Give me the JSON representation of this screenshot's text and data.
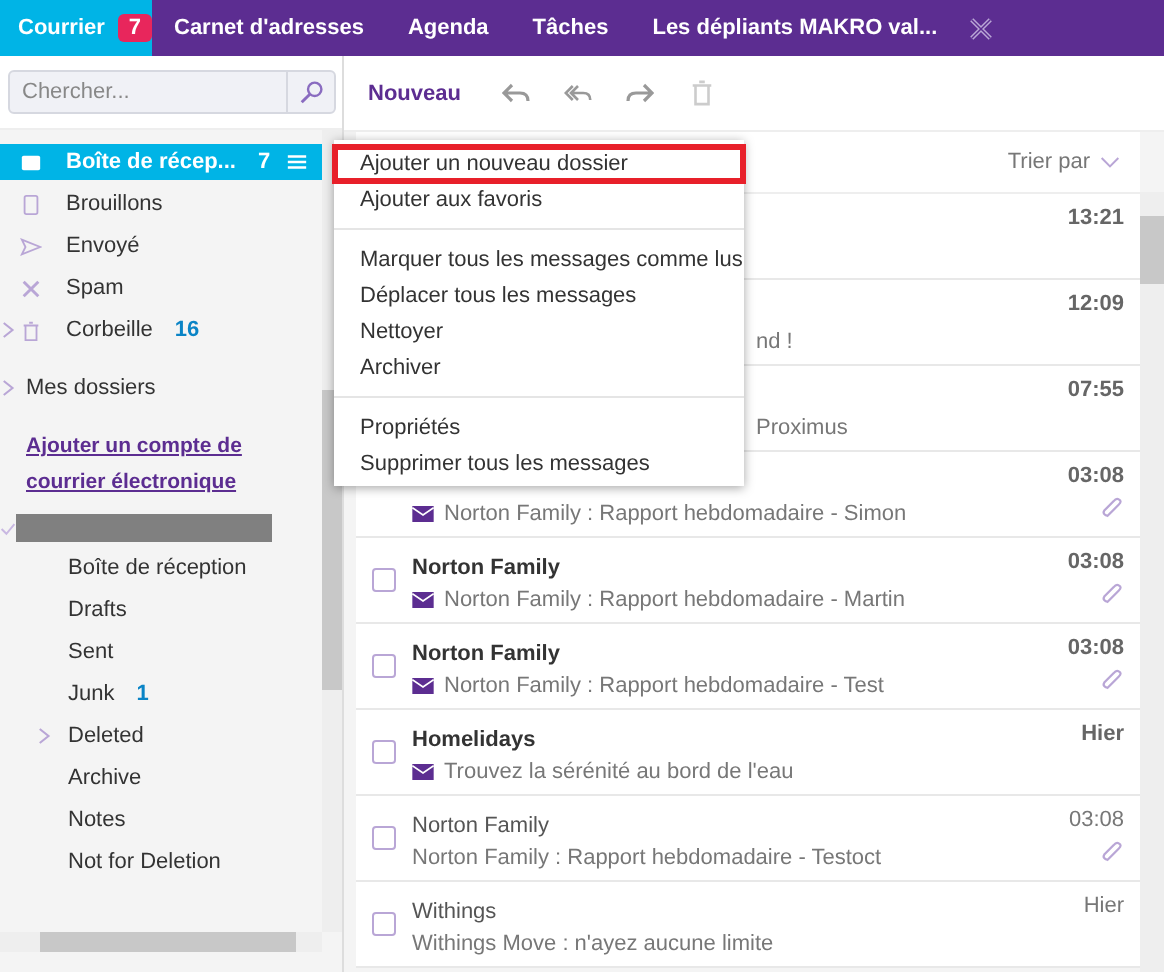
{
  "nav": {
    "tabs": [
      {
        "label": "Courrier",
        "badge": "7",
        "selected": true
      },
      {
        "label": "Carnet d'adresses",
        "selected": false
      },
      {
        "label": "Agenda",
        "selected": false
      },
      {
        "label": "Tâches",
        "selected": false
      },
      {
        "label": "Les dépliants MAKRO val...",
        "selected": false
      }
    ]
  },
  "search": {
    "placeholder": "Chercher..."
  },
  "toolbar": {
    "new_label": "Nouveau"
  },
  "folders": [
    {
      "label": "Boîte de récep...",
      "count": "7",
      "selected": true,
      "expandable": false
    },
    {
      "label": "Brouillons",
      "selected": false,
      "expandable": false
    },
    {
      "label": "Envoyé",
      "selected": false,
      "expandable": false
    },
    {
      "label": "Spam",
      "selected": false,
      "expandable": false
    },
    {
      "label": "Corbeille",
      "count": "16",
      "selected": false,
      "expandable": true
    }
  ],
  "my_folders": {
    "label": "Mes dossiers"
  },
  "add_account_link": "Ajouter un compte de courrier électronique",
  "account_folders": [
    {
      "label": "Boîte de réception",
      "expandable": false
    },
    {
      "label": "Drafts",
      "expandable": false
    },
    {
      "label": "Sent",
      "expandable": false
    },
    {
      "label": "Junk",
      "count": "1",
      "expandable": false
    },
    {
      "label": "Deleted",
      "expandable": true
    },
    {
      "label": "Archive",
      "expandable": false
    },
    {
      "label": "Notes",
      "expandable": false
    },
    {
      "label": "Not for Deletion",
      "expandable": false
    }
  ],
  "sort_label": "Trier par",
  "context_menu": [
    {
      "label": "Ajouter un nouveau dossier",
      "highlighted": true,
      "group_start": false
    },
    {
      "label": "Ajouter aux favoris",
      "highlighted": false,
      "group_start": false
    },
    {
      "label": "Marquer tous les messages comme lus",
      "highlighted": false,
      "group_start": true
    },
    {
      "label": "Déplacer tous les messages",
      "highlighted": false,
      "group_start": false
    },
    {
      "label": "Nettoyer",
      "highlighted": false,
      "group_start": false
    },
    {
      "label": "Archiver",
      "highlighted": false,
      "group_start": false
    },
    {
      "label": "Propriétés",
      "highlighted": false,
      "group_start": true
    },
    {
      "label": "Supprimer tous les messages",
      "highlighted": false,
      "group_start": false
    }
  ],
  "messages": [
    {
      "kind": "covered",
      "time": "13:21",
      "unread": true,
      "attachment": false
    },
    {
      "kind": "covered",
      "time": "12:09",
      "preview": "nd !",
      "unread": true,
      "attachment": false
    },
    {
      "kind": "covered",
      "time": "07:55",
      "preview": "Proximus",
      "unread": true,
      "attachment": false
    },
    {
      "kind": "covered-top",
      "time": "03:08",
      "preview": "Norton Family : Rapport hebdomadaire - Simon",
      "unread": true,
      "attachment": true
    },
    {
      "kind": "full",
      "sender": "Norton Family",
      "time": "03:08",
      "preview": "Norton Family : Rapport hebdomadaire - Martin",
      "unread": true,
      "attachment": true,
      "checked": false
    },
    {
      "kind": "full",
      "sender": "Norton Family",
      "time": "03:08",
      "preview": "Norton Family : Rapport hebdomadaire - Test",
      "unread": true,
      "attachment": true,
      "checked": false
    },
    {
      "kind": "full",
      "sender": "Homelidays",
      "time": "Hier",
      "preview": "Trouvez la sérénité au bord de l'eau",
      "unread": true,
      "attachment": false,
      "checked": false
    },
    {
      "kind": "full",
      "sender": "Norton Family",
      "time": "03:08",
      "preview": "Norton Family : Rapport hebdomadaire - Testoct",
      "unread": false,
      "attachment": true,
      "checked": false
    },
    {
      "kind": "full",
      "sender": "Withings",
      "time": "Hier",
      "preview": "Withings Move : n'ayez aucune limite",
      "unread": false,
      "attachment": false,
      "checked": false
    }
  ]
}
